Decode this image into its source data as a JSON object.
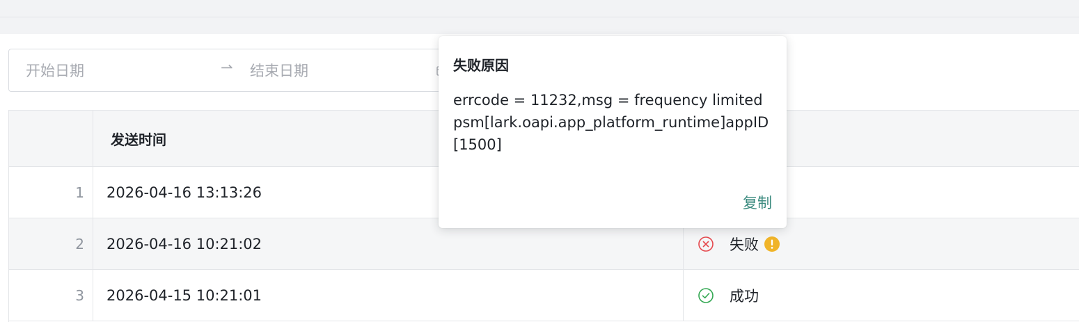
{
  "filter": {
    "start_placeholder": "开始日期",
    "range_separator": "⇀",
    "end_placeholder": "结束日期"
  },
  "table": {
    "columns": {
      "index": "",
      "send_time": "发送时间",
      "status": ""
    },
    "rows": [
      {
        "index": "1",
        "send_time": "2026-04-16 13:13:26",
        "status": "",
        "status_icon": ""
      },
      {
        "index": "2",
        "send_time": "2026-04-16 10:21:02",
        "status": "失败",
        "status_icon": "error-circle-icon"
      },
      {
        "index": "3",
        "send_time": "2026-04-15 10:21:01",
        "status": "成功",
        "status_icon": "success-circle-icon"
      }
    ]
  },
  "popover": {
    "title": "失败原因",
    "message": "errcode = 11232,msg = frequency limited psm[lark.oapi.app_platform_runtime]appID[1500]",
    "copy_label": "复制"
  },
  "colors": {
    "error": "#e5484d",
    "success": "#34a853",
    "warning": "#f0b429",
    "link": "#3a8a7e"
  }
}
